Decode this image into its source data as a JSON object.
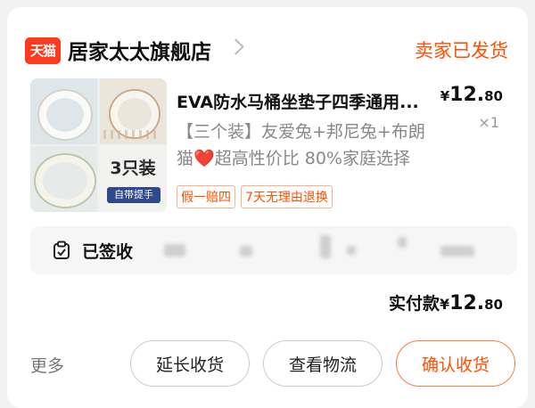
{
  "shop": {
    "badge": "天猫",
    "name": "居家太太旗舰店",
    "status": "卖家已发货"
  },
  "product": {
    "title": "EVA防水马桶坐垫子四季通用...",
    "price_currency": "¥",
    "price_int": "12.",
    "price_dec": "80",
    "quantity": "×1",
    "sku_line1": "【三个装】友爱兔+邦尼兔+布朗",
    "sku_line2_before": "猫",
    "sku_heart": "❤️",
    "sku_line2_after": "超高性价比 80%家庭选择",
    "image_pack_label": "3只装",
    "image_pack_sub": "自带提手",
    "tags": [
      "假一赔四",
      "7天无理由退换"
    ]
  },
  "logistics": {
    "status": "已签收"
  },
  "total": {
    "label": "实付款",
    "currency": "¥",
    "int": "12.",
    "dec": "80"
  },
  "actions": {
    "more": "更多",
    "extend": "延长收货",
    "track": "查看物流",
    "confirm": "确认收货"
  },
  "colors": {
    "accent": "#ff5000",
    "tmall_red": "#ff3a1e"
  }
}
